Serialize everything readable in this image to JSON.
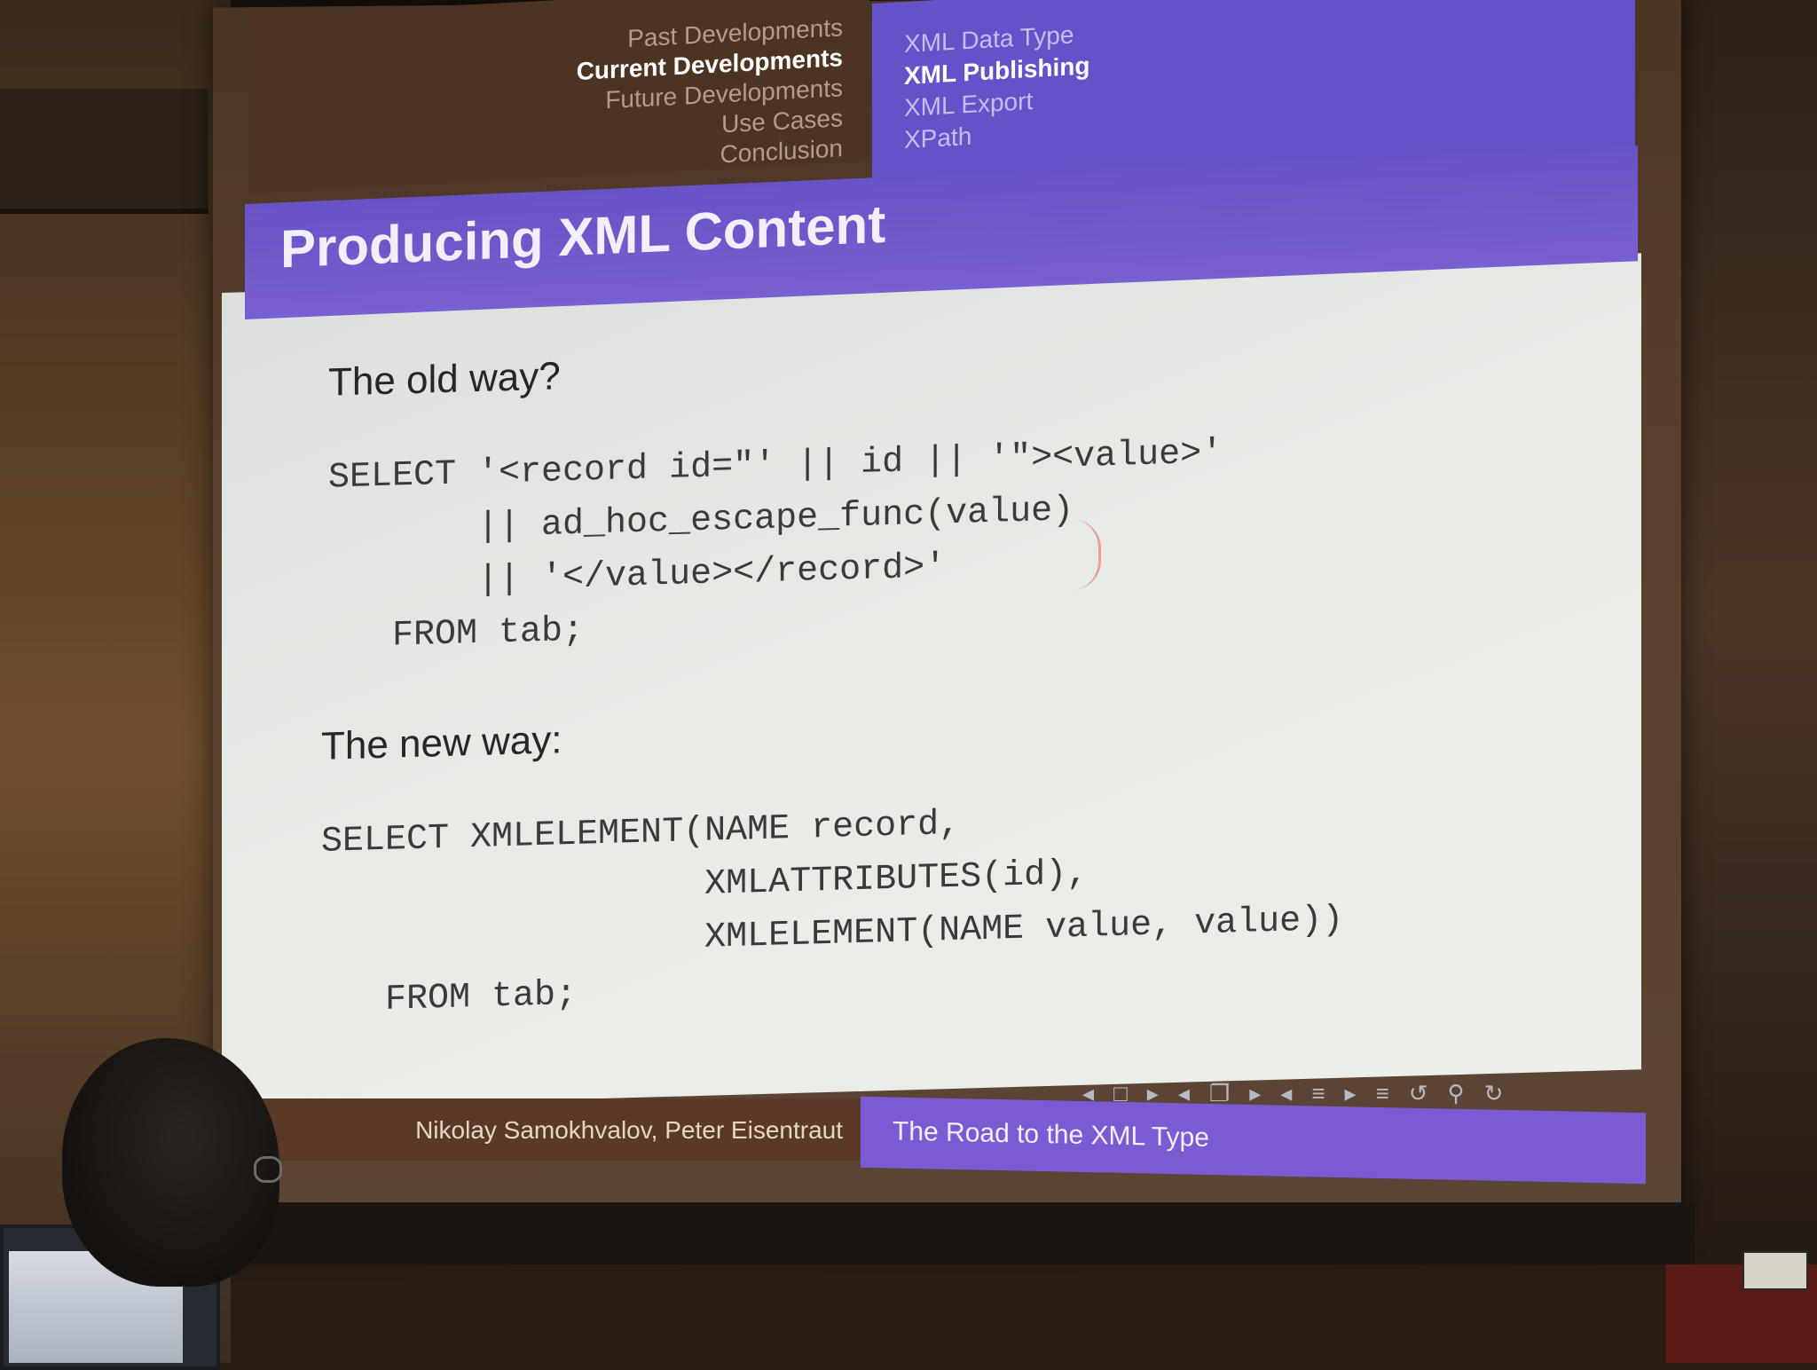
{
  "nav": {
    "sections": [
      {
        "label": "Past Developments",
        "active": false
      },
      {
        "label": "Current Developments",
        "active": true
      },
      {
        "label": "Future Developments",
        "active": false
      },
      {
        "label": "Use Cases",
        "active": false
      },
      {
        "label": "Conclusion",
        "active": false
      }
    ],
    "subsections": [
      {
        "label": "XML Data Type",
        "active": false
      },
      {
        "label": "XML Publishing",
        "active": true
      },
      {
        "label": "XML Export",
        "active": false
      },
      {
        "label": "XPath",
        "active": false
      }
    ]
  },
  "slide": {
    "title": "Producing XML Content",
    "old_heading": "The old way?",
    "old_code": [
      "SELECT '<record id=\"' || id || '\"><value>'",
      "       || ad_hoc_escape_func(value)",
      "       || '</value></record>'",
      "   FROM tab;"
    ],
    "new_heading": "The new way:",
    "new_code": [
      "SELECT XMLELEMENT(NAME record,",
      "                  XMLATTRIBUTES(id),",
      "                  XMLELEMENT(NAME value, value))",
      "   FROM tab;"
    ]
  },
  "footer": {
    "authors": "Nikolay Samokhvalov, Peter Eisentraut",
    "talk_title": "The Road to the XML Type"
  },
  "colors": {
    "accent": "#6a54c8",
    "header_dark": "#4c3322",
    "slide_bg": "#e6e8e4"
  }
}
